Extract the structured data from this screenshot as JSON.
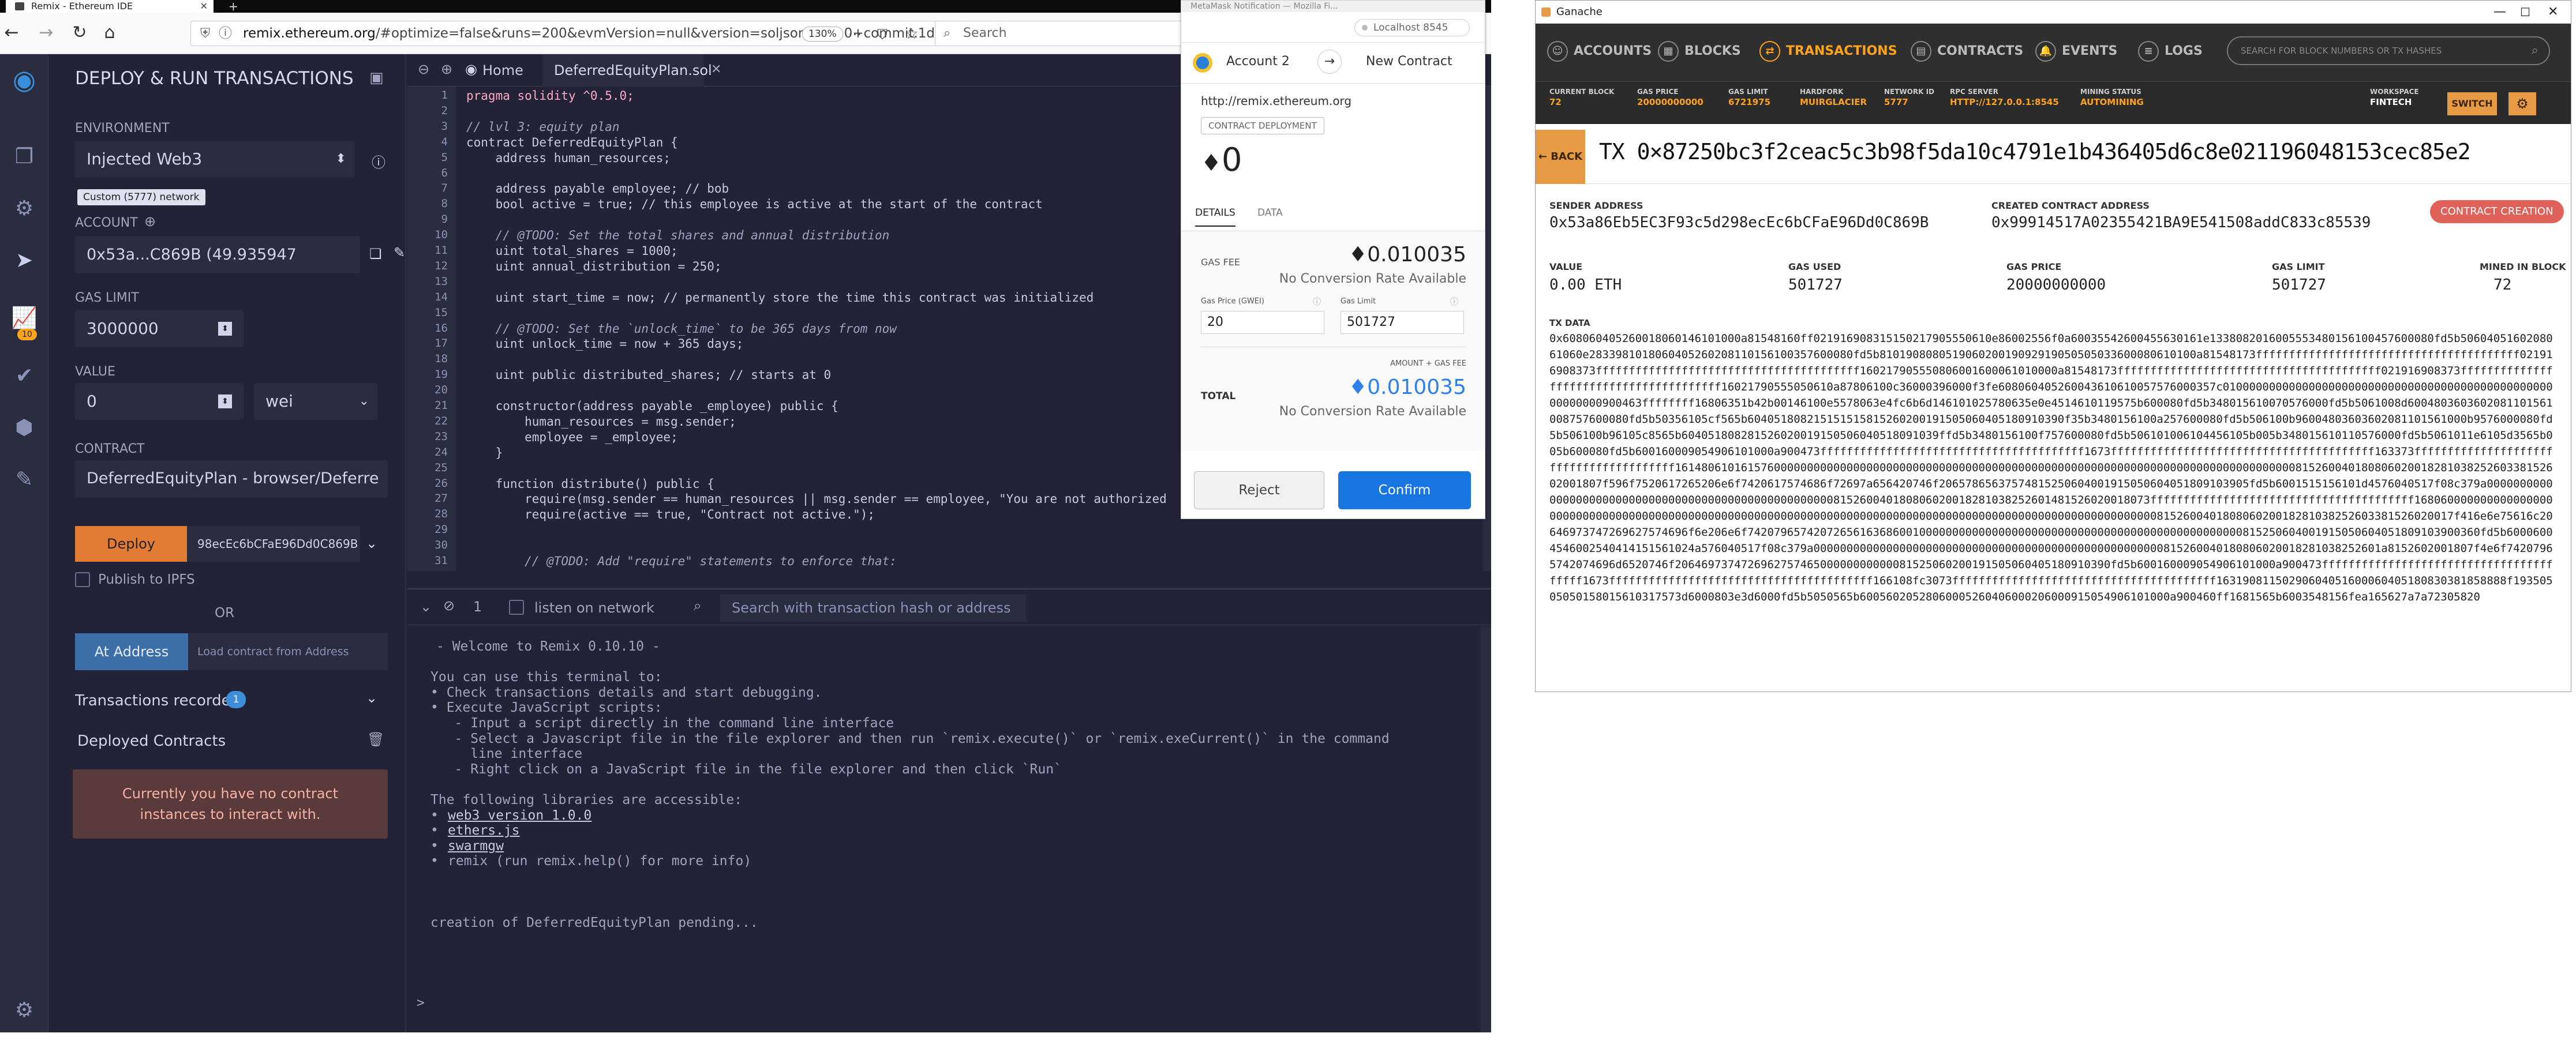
{
  "firefox": {
    "tab_title": "Remix - Ethereum IDE",
    "url_host": "remix.ethereum.org",
    "url_prefix": "",
    "url_rest": "/#optimize=false&runs=200&evmVersion=null&version=soljson-v0.5.0+commit.1d4",
    "zoom": "130%",
    "search_placeholder": "Search"
  },
  "remix_panel": {
    "title": "DEPLOY & RUN TRANSACTIONS",
    "environment_label": "ENVIRONMENT",
    "environment_value": "Injected Web3",
    "network_tooltip": "Custom (5777) network",
    "account_label": "ACCOUNT",
    "account_value": "0x53a...C869B (49.935947",
    "gas_limit_label": "GAS LIMIT",
    "gas_limit_value": "3000000",
    "value_label": "VALUE",
    "value_value": "0",
    "value_unit": "wei",
    "contract_label": "CONTRACT",
    "contract_value": "DeferredEquityPlan - browser/Deferre",
    "deploy_label": "Deploy",
    "deploy_arg": "98ecEc6bCFaE96Dd0C869B",
    "publish_label": "Publish to IPFS",
    "or_label": "OR",
    "at_address_label": "At Address",
    "load_contract_placeholder": "Load contract from Address",
    "transactions_recorded_label": "Transactions recorded",
    "transactions_recorded_count": "1",
    "deployed_contracts_label": "Deployed Contracts",
    "no_instances_msg": "Currently you have no contract instances to interact with."
  },
  "icon_badge": "10",
  "editor": {
    "home_tab": "Home",
    "file_tab": "DeferredEquityPlan.sol",
    "line_numbers": [
      "1",
      "2",
      "3",
      "4",
      "5",
      "6",
      "7",
      "8",
      "9",
      "10",
      "11",
      "12",
      "13",
      "14",
      "15",
      "16",
      "17",
      "18",
      "19",
      "20",
      "21",
      "22",
      "23",
      "24",
      "25",
      "26",
      "27",
      "28",
      "29",
      "30",
      "31"
    ],
    "lines": [
      "pragma solidity ^0.5.0;",
      "",
      "// lvl 3: equity plan",
      "contract DeferredEquityPlan {",
      "    address human_resources;",
      "",
      "    address payable employee; // bob",
      "    bool active = true; // this employee is active at the start of the contract",
      "",
      "    // @TODO: Set the total shares and annual distribution",
      "    uint total_shares = 1000;",
      "    uint annual_distribution = 250;",
      "",
      "    uint start_time = now; // permanently store the time this contract was initialized",
      "",
      "    // @TODO: Set the `unlock_time` to be 365 days from now",
      "    uint unlock_time = now + 365 days;",
      "",
      "    uint public distributed_shares; // starts at 0",
      "",
      "    constructor(address payable _employee) public {",
      "        human_resources = msg.sender;",
      "        employee = _employee;",
      "    }",
      "",
      "    function distribute() public {",
      "        require(msg.sender == human_resources || msg.sender == employee, \"You are not authorized",
      "        require(active == true, \"Contract not active.\");",
      "",
      "",
      "        // @TODO: Add \"require\" statements to enforce that:"
    ]
  },
  "terminal": {
    "counter": "1",
    "listen_label": "listen on network",
    "search_placeholder": "Search with transaction hash or address",
    "lines": [
      "- Welcome to Remix 0.10.10 -",
      "",
      "You can use this terminal to:",
      "• Check transactions details and start debugging.",
      "• Execute JavaScript scripts:",
      "   - Input a script directly in the command line interface",
      "   - Select a Javascript file in the file explorer and then run `remix.execute()` or `remix.exeCurrent()` in the command",
      "     line interface",
      "   - Right click on a JavaScript file in the file explorer and then click `Run`",
      "",
      "The following libraries are accessible:"
    ],
    "libs": [
      "web3 version 1.0.0",
      "ethers.js",
      "swarmgw"
    ],
    "libs_last": "remix (run remix.help() for more info)",
    "pending": "creation of DeferredEquityPlan pending...",
    "prompt": ">"
  },
  "metamask": {
    "window_title": "MetaMask Notification — Mozilla Fi...",
    "network": "Localhost 8545",
    "account": "Account 2",
    "new_contract": "New Contract",
    "origin": "http://remix.ethereum.org",
    "badge": "CONTRACT DEPLOYMENT",
    "amount": "0",
    "tab_details": "DETAILS",
    "tab_data": "DATA",
    "gas_fee_label": "GAS FEE",
    "gas_fee": "0.010035",
    "no_conversion": "No Conversion Rate Available",
    "gas_price_label": "Gas Price (GWEI)",
    "gas_price": "20",
    "gas_limit_label": "Gas Limit",
    "gas_limit": "501727",
    "amount_gas_label": "AMOUNT + GAS FEE",
    "total_label": "TOTAL",
    "total": "0.010035",
    "no_conversion2": "No Conversion Rate Available",
    "reject": "Reject",
    "confirm": "Confirm"
  },
  "ganache": {
    "window_title": "Ganache",
    "nav": [
      "ACCOUNTS",
      "BLOCKS",
      "TRANSACTIONS",
      "CONTRACTS",
      "EVENTS",
      "LOGS"
    ],
    "search_placeholder": "SEARCH FOR BLOCK NUMBERS OR TX HASHES",
    "status": [
      {
        "k": "CURRENT BLOCK",
        "v": "72"
      },
      {
        "k": "GAS PRICE",
        "v": "20000000000"
      },
      {
        "k": "GAS LIMIT",
        "v": "6721975"
      },
      {
        "k": "HARDFORK",
        "v": "MUIRGLACIER"
      },
      {
        "k": "NETWORK ID",
        "v": "5777"
      },
      {
        "k": "RPC SERVER",
        "v": "HTTP://127.0.0.1:8545"
      },
      {
        "k": "MINING STATUS",
        "v": "AUTOMINING"
      }
    ],
    "workspace_label": "WORKSPACE",
    "workspace_value": "FINTECH",
    "switch_label": "SWITCH",
    "back_label": "← BACK",
    "tx_title": "TX 0×87250bc3f2ceac5c3b98f5da10c4791e1b436405d6c8e021196048153cec85e2",
    "sender_label": "SENDER ADDRESS",
    "sender": "0x53a86Eb5EC3F93c5d298ecEc6bCFaE96Dd0C869B",
    "created_label": "CREATED CONTRACT ADDRESS",
    "created": "0x99914517A02355421BA9E541508addC833c85539",
    "badge": "CONTRACT CREATION",
    "value_label": "VALUE",
    "value": "0.00 ETH",
    "gas_used_label": "GAS USED",
    "gas_used": "501727",
    "gas_price_label": "GAS PRICE",
    "gas_price": "20000000000",
    "gas_limit_label": "GAS LIMIT",
    "gas_limit": "501727",
    "mined_label": "MINED IN BLOCK",
    "mined": "72",
    "tx_data_label": "TX DATA",
    "tx_data": "0x608060405260018060146101000a81548160ff021916908315150217905550610e86002556f0a60035542600455630161e1338082016005553480156100457600080fd5b5060405160208061060e2833981018060405260208110156100357600080fd5b810190808051906020019092919050505033600080610100a81548173ffffffffffffffffffffffffffffffffffffffff021916908373ffffffffffffffffffffffffffffffffffffffff160217905550806001600061010000a81548173ffffffffffffffffffffffffffffffffffffffff021916908373ffffffffffffffffffffffffffffffffffffffff16021790555050610a87806100c36000396000f3fe608060405260043610610057576000357c0100000000000000000000000000000000000000000000000000000000900463ffffffff16806351b42b00146100e5578063e4fc6b6d146101025780635e0e4514610119575b600080fd5b348015610070576000fd5b5061008d6004803603602081101561008757600080fd5b50356105cf565b604051808215151515815260200191505060405180910390f35b3480156100a257600080fd5b506100b96004803603602081101561000b9576000080fd5b506100b96105c8565b604051808281526020019150506040518091039ffd5b3480156100f757600080fd5b506101006104456105b005b348015610110576000fd5b5061011e6105d3565b005b600080fd5b600160009054906101000a900473ffffffffffffffffffffffffffffffffffffffff1673ffffffffffffffffffffffffffffffffffffffff163373ffffffffffffffffffffffffffffffffffffffff161480610161576000000000000000000000000000000000000000000000000000000000000000000000000000000081526004018080602001828103825260338152602001807f596f7520617265206e6f7420617574686f72697a656420746f20657865637574815250604001915050604051809103905fd5b6001515156101d4576040517f08c379a00000000000000000000000000000000000000000000000000000815260040180806020018281038252601481526020018073ffffffffffffffffffffffffffffffffffffffff16806000000000000000000000000000000000000000000000000000000000000000000000000000000000000000000000000000000000000815260040180806020018281038252603381526020017f416e6e75616c20646973747269627574696f6e206e6f742079657420726561636860010000000000000000000000000000000000000000000000000815250604001915050604051809103900360fd5b60006004546002540414151561024a576040517f08c379a00000000000000000000000000000000000000000000000000000815260040180806020018281038252601a8152602001807f4e6f74207965742074696d6520746f206469737472696275746500000000000081525060200191505060405180910390fd5b600160009054906101000a900473ffffffffffffffffffffffffffffffffffffffff1673ffffffffffffffffffffffffffffffffffffffff166108fc3073ffffffffffffffffffffffffffffffffffffffff16319081150290604051600060405180830381858888f19350505050158015610317573d6000803e3d6000fd5b5050565b60056020528060005260406000206000915054906101000a900460ff1681565b6003548156fea165627a7a72305820"
  }
}
